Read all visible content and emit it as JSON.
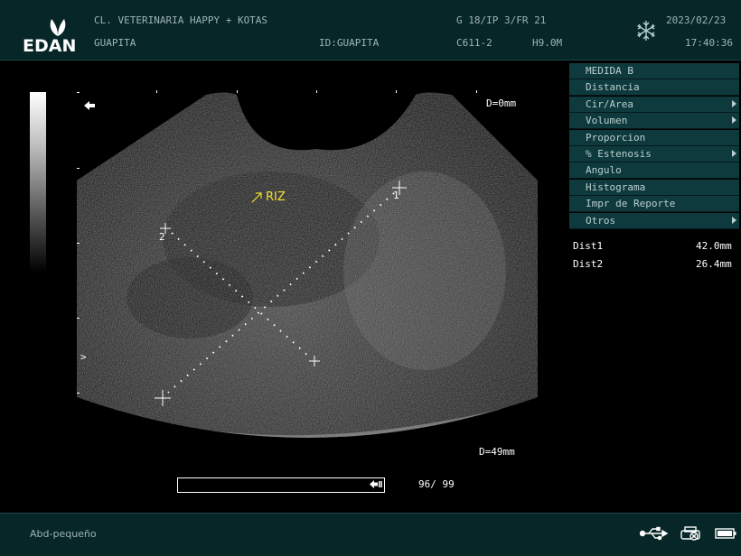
{
  "header": {
    "logo_text": "EDAN",
    "clinic": "CL. VETERINARIA HAPPY + KOTAS",
    "patient_name": "GUAPITA",
    "patient_id": "ID:GUAPITA",
    "params_line1": "G 18/IP 3/FR 21",
    "probe": "C611-2",
    "frequency": "H9.0M",
    "date": "2023/02/23",
    "time": "17:40:36",
    "freeze_icon": "snowflake-icon"
  },
  "image": {
    "depth_top": "D=0mm",
    "depth_bottom": "D=49mm",
    "annotation": "RIZ",
    "caliper1_label": "1",
    "caliper2_label": "2",
    "focus_marker": ">"
  },
  "cine": {
    "counter": "96/ 99",
    "progress": 0.97
  },
  "menu": {
    "items": [
      {
        "label": "MEDIDA B",
        "has_submenu": false
      },
      {
        "label": "Distancia",
        "has_submenu": false
      },
      {
        "label": "Cir/Area",
        "has_submenu": true
      },
      {
        "label": "Volumen",
        "has_submenu": true
      },
      {
        "label": "Proporcion",
        "has_submenu": false
      },
      {
        "label": "% Estenosis",
        "has_submenu": true
      },
      {
        "label": "Angulo",
        "has_submenu": false
      },
      {
        "label": "Histograma",
        "has_submenu": false
      },
      {
        "label": "Impr de Reporte",
        "has_submenu": false
      },
      {
        "label": "Otros",
        "has_submenu": true
      }
    ]
  },
  "results": [
    {
      "name": "Dist1",
      "value": "42.0mm"
    },
    {
      "name": "Dist2",
      "value": "26.4mm"
    }
  ],
  "footer": {
    "preset": "Abd-pequeño",
    "icons": [
      "usb-icon",
      "printer-icon",
      "battery-icon"
    ]
  },
  "colors": {
    "header_bg": "#062628",
    "menu_bg": "#0f3a3d",
    "annotation": "#f0e030"
  }
}
